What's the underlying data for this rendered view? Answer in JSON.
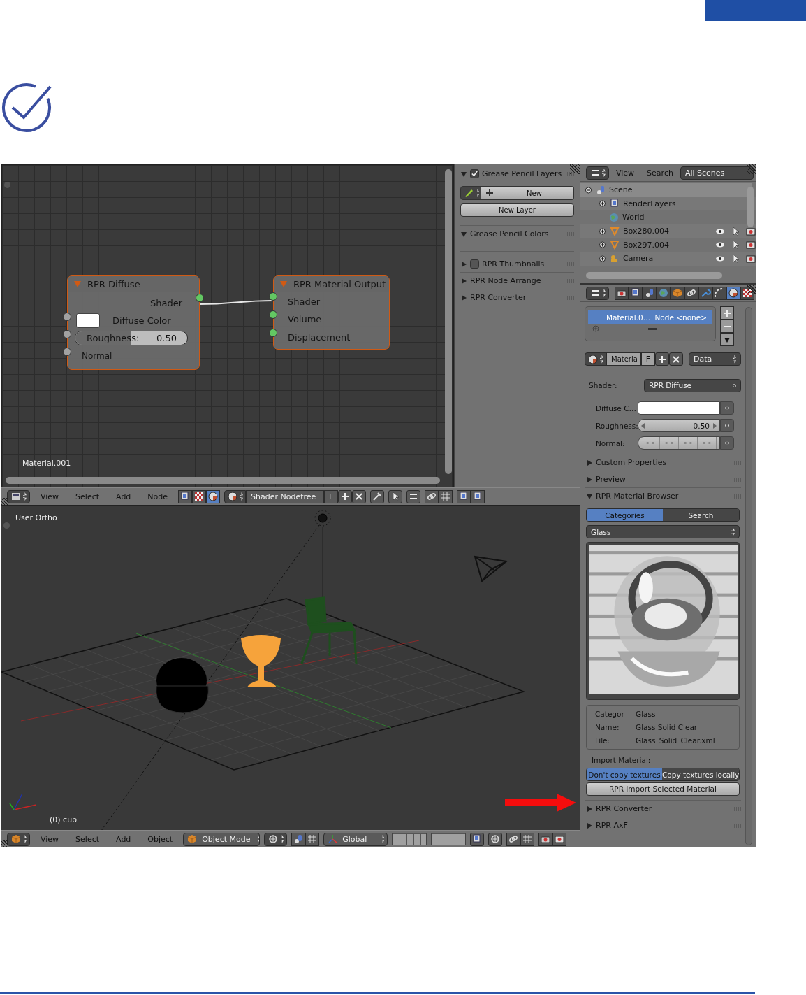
{
  "node_editor": {
    "material_name": "Material.001",
    "nodes": [
      {
        "title": "RPR Diffuse",
        "outputs": [
          "Shader"
        ],
        "inputs": [
          {
            "kind": "color",
            "label": "Diffuse Color"
          },
          {
            "kind": "slider",
            "label": "Roughness:",
            "value": "0.50",
            "level": 0.5
          },
          {
            "kind": "socket",
            "label": "Normal"
          }
        ]
      },
      {
        "title": "RPR Material Output",
        "inputs": [
          {
            "kind": "linked",
            "label": "Shader"
          },
          {
            "kind": "linked",
            "label": "Volume"
          },
          {
            "kind": "linked",
            "label": "Displacement"
          }
        ]
      }
    ]
  },
  "tool_panel": {
    "panels": [
      {
        "kind": "checkbox",
        "checked": true,
        "title": "Grease Pencil Layers",
        "expanded": true,
        "buttons": [
          "New",
          "New Layer"
        ]
      },
      {
        "kind": "plain",
        "title": "Grease Pencil Colors",
        "expanded": true
      },
      {
        "kind": "checkbox",
        "checked": false,
        "title": "RPR Thumbnails",
        "expanded": false
      },
      {
        "kind": "plain",
        "title": "RPR Node Arrange",
        "expanded": false
      },
      {
        "kind": "plain",
        "title": "RPR Converter",
        "expanded": false
      }
    ]
  },
  "node_header": {
    "menus": [
      "View",
      "Select",
      "Add",
      "Node"
    ],
    "datablock": "Shader Nodetree",
    "fake_user": "F"
  },
  "viewport": {
    "view_name": "User Ortho",
    "object_label": "(0) cup"
  },
  "viewport_header": {
    "menus": [
      "View",
      "Select",
      "Add",
      "Object"
    ],
    "mode": "Object Mode",
    "orientation": "Global"
  },
  "outliner": {
    "menus": [
      "View",
      "Search"
    ],
    "display": "All Scenes",
    "tree": [
      {
        "label": "Scene",
        "expanded": true,
        "children": [
          {
            "label": "RenderLayers",
            "expanded": false
          },
          {
            "label": "World"
          },
          {
            "label": "Box280.004",
            "expanded": false
          },
          {
            "label": "Box297.004",
            "expanded": false
          },
          {
            "label": "Camera",
            "expanded": false
          }
        ]
      }
    ]
  },
  "properties": {
    "context_tabs": [
      {
        "selected": false
      },
      {
        "selected": false
      },
      {
        "selected": false
      },
      {
        "selected": false
      },
      {
        "selected": false
      },
      {
        "selected": false
      },
      {
        "selected": false
      },
      {
        "selected": false
      },
      {
        "selected": true
      },
      {
        "selected": false
      }
    ],
    "slot": {
      "material": "Material.0…",
      "node": "Node <none>"
    },
    "datablock": {
      "name": "Materia",
      "fake_user": "F",
      "link": "Data"
    },
    "shader": {
      "label": "Shader:",
      "value": "RPR Diffuse"
    },
    "fields": [
      {
        "kind": "color",
        "label": "Diffuse C…"
      },
      {
        "kind": "number",
        "label": "Roughness:",
        "value": "0.50"
      },
      {
        "kind": "vector",
        "label": "Normal:"
      }
    ],
    "panels_before": [
      {
        "title": "Custom Properties",
        "expanded": false
      },
      {
        "title": "Preview",
        "expanded": false
      }
    ],
    "browser": {
      "title": "RPR Material Browser",
      "expanded": true,
      "tabs": [
        {
          "label": "Categories",
          "selected": true
        },
        {
          "label": "Search",
          "selected": false
        }
      ],
      "category": "Glass",
      "info": [
        {
          "label": "Categor",
          "value": "Glass"
        },
        {
          "label": "Name:",
          "value": "Glass Solid Clear"
        },
        {
          "label": "File:",
          "value": "Glass_Solid_Clear.xml"
        }
      ],
      "import_label": "Import Material:",
      "import_options": [
        {
          "label": "Don't copy textures",
          "selected": true
        },
        {
          "label": "Copy textures locally",
          "selected": false
        }
      ],
      "import_button": "RPR Import Selected Material"
    },
    "panels_after": [
      {
        "title": "RPR Converter",
        "expanded": false
      },
      {
        "title": "RPR AxF",
        "expanded": false
      }
    ]
  }
}
